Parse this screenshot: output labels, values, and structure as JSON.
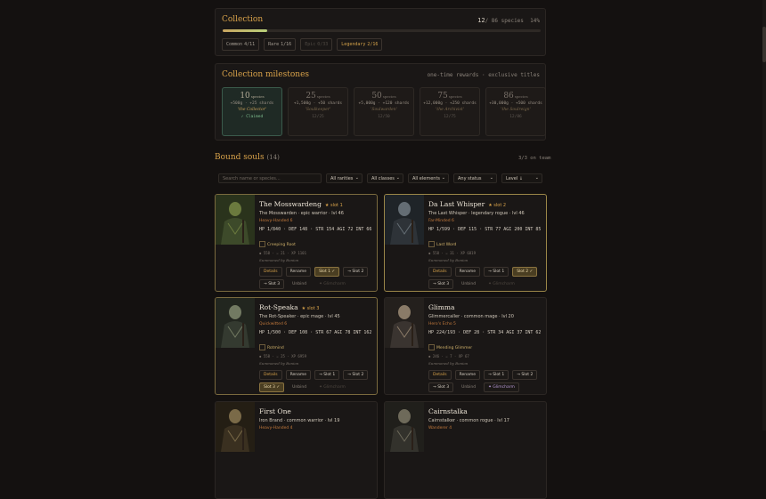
{
  "collection": {
    "title": "Collection",
    "count": "12",
    "total": "/ 86 species",
    "percent": "14%",
    "progress_fraction": 0.14,
    "chips": [
      {
        "label": "Common",
        "value": "4/11"
      },
      {
        "label": "Rare",
        "value": "1/16"
      },
      {
        "label": "Epic",
        "value": "0/33"
      },
      {
        "label": "Legendary",
        "value": "2/16"
      }
    ]
  },
  "milestones": {
    "title": "Collection milestones",
    "note": "one-time rewards · exclusive titles",
    "items": [
      {
        "num": "10",
        "unit": "species",
        "reward": "+500g · +25 shards",
        "title": "'the Collector'",
        "status": "✓ Claimed"
      },
      {
        "num": "25",
        "unit": "species",
        "reward": "+1,500g · +50 shards",
        "title": "'Soulkeeper'",
        "status": "12/25"
      },
      {
        "num": "50",
        "unit": "species",
        "reward": "+5,000g · +120 shards",
        "title": "'Soulwarden'",
        "status": "12/50"
      },
      {
        "num": "75",
        "unit": "species",
        "reward": "+12,000g · +250 shards",
        "title": "'the Archivist'",
        "status": "12/75"
      },
      {
        "num": "86",
        "unit": "species",
        "reward": "+30,000g · +500 shards",
        "title": "'the Soulreign'",
        "status": "12/86"
      }
    ]
  },
  "bound": {
    "title": "Bound souls",
    "count": "(14)",
    "on_team": "3/3 on team",
    "search_placeholder": "Search name or species...",
    "filters": [
      "All rarities",
      "All classes",
      "All elements",
      "Any status",
      "Level ↓"
    ]
  },
  "cards": [
    {
      "name": "The Mosswardeng",
      "slot": "slot 1",
      "sub": "The Mosswarden · epic warrior · lvl 46",
      "trait": "Heavy-Handed 6",
      "stats": "HP 1/840 · DEF 148 · STR 154 AGI 72 INT 66",
      "skill": "Creeping Root",
      "meta": "◆ 558 · ⚔ 21 · XP 1101",
      "summoned": "Summoned by Bonion",
      "buttons": [
        "Details",
        "Rename",
        "Slot 1 ✓",
        "→ Slot 2",
        "→ Slot 3",
        "Unbind",
        "✦ Glimcharm"
      ]
    },
    {
      "name": "Da Last Whisper",
      "slot": "slot 2",
      "sub": "The Last Whisper · legendary rogue · lvl 46",
      "trait": "Far-Minded 6",
      "stats": "HP 1/599 · DEF 115 · STR 77 AGI 200 INT 85",
      "skill": "Last Word",
      "meta": "◆ 558 · ⚔ 31 · XP 6819",
      "summoned": "Summoned by Bonion",
      "buttons": [
        "Details",
        "Rename",
        "→ Slot 1",
        "Slot 2 ✓",
        "→ Slot 3",
        "Unbind",
        "✦ Glimcharm"
      ]
    },
    {
      "name": "Rot-Speaka",
      "slot": "slot 3",
      "sub": "The Rot-Speaker · epic mage · lvl 45",
      "trait": "Quickwitted 6",
      "stats": "HP 1/500 · DEF 108 · STR 67 AGI 78 INT 162",
      "skill": "Rotmind",
      "meta": "◆ 558 · ⚔ 25 · XP 6959",
      "summoned": "Summoned by Bonion",
      "buttons": [
        "Details",
        "Rename",
        "→ Slot 1",
        "→ Slot 2",
        "Slot 3 ✓",
        "Unbind",
        "✦ Glimcharm"
      ]
    },
    {
      "name": "Glimma",
      "slot": "",
      "sub": "Glimmercaller · common mage · lvl 20",
      "trait": "Hero's Echo 5",
      "stats": "HP 224/193 · DEF 28 · STR 34 AGI 37 INT 62",
      "skill": "Mending Glimmer",
      "meta": "◆ 246 · ⚔ 7 · XP 67",
      "summoned": "Summoned by Bonion",
      "buttons": [
        "Details",
        "Rename",
        "→ Slot 1",
        "→ Slot 2",
        "→ Slot 3",
        "Unbind",
        "✦ Glimcharm"
      ]
    },
    {
      "name": "First One",
      "slot": "",
      "sub": "Iron Brand · common warrior · lvl 19",
      "trait": "Heavy-Handed 4",
      "stats": "",
      "skill": "",
      "meta": "",
      "summoned": "",
      "buttons": []
    },
    {
      "name": "Cairnstalka",
      "slot": "",
      "sub": "Cairnstalker · common rogue · lvl 17",
      "trait": "Wanderer 4",
      "stats": "",
      "skill": "",
      "meta": "",
      "summoned": "",
      "buttons": []
    }
  ]
}
